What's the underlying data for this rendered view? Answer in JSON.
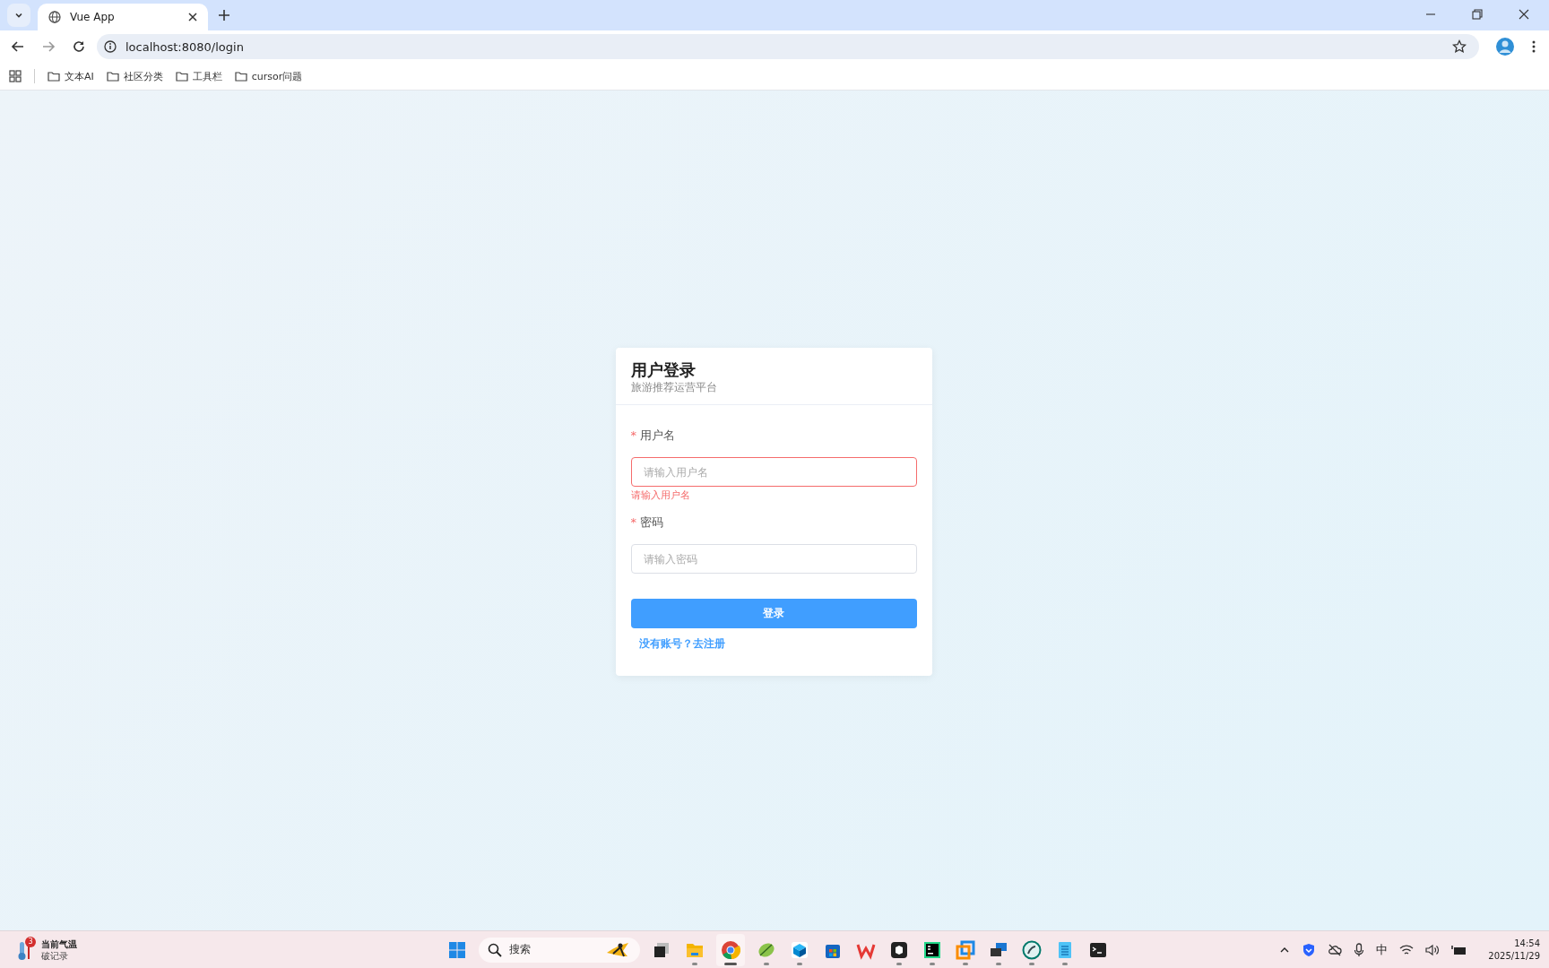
{
  "browser": {
    "tabs": [
      {
        "title": "Vue App",
        "selected": true
      }
    ],
    "url": "localhost:8080/login",
    "bookmarks": [
      {
        "label": "文本AI"
      },
      {
        "label": "社区分类"
      },
      {
        "label": "工具栏"
      },
      {
        "label": "cursor问题"
      }
    ]
  },
  "login": {
    "title": "用户登录",
    "subtitle": "旅游推荐运营平台",
    "fields": [
      {
        "required_mark": "*",
        "label": "用户名",
        "placeholder": "请输入用户名",
        "error": "请输入用户名"
      },
      {
        "required_mark": "*",
        "label": "密码",
        "placeholder": "请输入密码"
      }
    ],
    "submit": "登录",
    "register_link": "没有账号？去注册"
  },
  "taskbar": {
    "weather": {
      "badge": "3",
      "title": "当前气温",
      "subtitle": "破记录"
    },
    "search": {
      "placeholder": "搜索"
    },
    "apps": [
      {
        "kind": "start",
        "running": false,
        "active": false
      },
      {
        "kind": "taskview",
        "running": false,
        "active": false
      },
      {
        "kind": "folder",
        "running": true,
        "active": false
      },
      {
        "kind": "chrome",
        "running": true,
        "active": true
      },
      {
        "kind": "leaf",
        "running": true,
        "active": false
      },
      {
        "kind": "cube",
        "running": true,
        "active": false
      },
      {
        "kind": "store",
        "running": false,
        "active": false
      },
      {
        "kind": "wps",
        "running": false,
        "active": false
      },
      {
        "kind": "box",
        "running": true,
        "active": false
      },
      {
        "kind": "ide",
        "running": true,
        "active": false
      },
      {
        "kind": "squares",
        "running": true,
        "active": false
      },
      {
        "kind": "windows",
        "running": true,
        "active": false
      },
      {
        "kind": "globe",
        "running": true,
        "active": false
      },
      {
        "kind": "notepad",
        "running": true,
        "active": false
      },
      {
        "kind": "terminal",
        "running": false,
        "active": false
      }
    ],
    "ime": "中",
    "time": "14:54",
    "date": "2025/11/29"
  }
}
